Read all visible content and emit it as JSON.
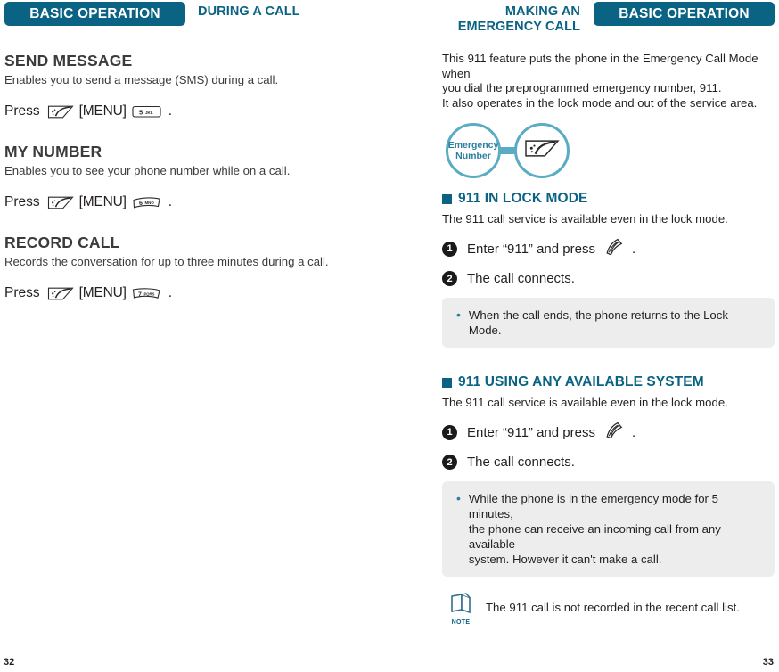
{
  "header": {
    "left_banner": "BASIC OPERATION",
    "left_crumb": "DURING A CALL",
    "right_crumb_line1": "MAKING AN",
    "right_crumb_line2": "EMERGENCY CALL",
    "right_banner": "BASIC OPERATION",
    "banner_color": "#0a6383",
    "crumb_color": "#0a6383"
  },
  "left_page": {
    "features": [
      {
        "title": "SEND MESSAGE",
        "desc": "Enables you to send a message (SMS) during a call.",
        "press_label": "Press",
        "menu_label": "[MENU]",
        "key_label": "5",
        "key_sub": "JKL",
        "period": "."
      },
      {
        "title": "MY NUMBER",
        "desc": "Enables you to see your phone number while on a call.",
        "press_label": "Press",
        "menu_label": "[MENU]",
        "key_label": "6",
        "key_sub": "MNO",
        "period": "."
      },
      {
        "title": "RECORD CALL",
        "desc": "Records the conversation for up to three minutes during a call.",
        "press_label": "Press",
        "menu_label": "[MENU]",
        "key_label": "7",
        "key_sub": "PQRS",
        "period": "."
      }
    ]
  },
  "right_page": {
    "intro_line1": "This 911 feature puts the phone in the Emergency Call Mode when",
    "intro_line2": "you dial the preprogrammed emergency number, 911.",
    "intro_line3": "It also operates in the lock mode and out of the service area.",
    "diagram": {
      "circle_label_line1": "Emergency",
      "circle_label_line2": "Number",
      "circle_color": "#5aabc4",
      "text_color": "#2d7fa0"
    },
    "sections": [
      {
        "heading": "911 IN LOCK MODE",
        "subtext": "The 911 call service is available even in the lock mode.",
        "steps": [
          {
            "num": "1",
            "text_before": "Enter “911” and press",
            "text_after": "."
          },
          {
            "num": "2",
            "text_before": "The call connects.",
            "text_after": ""
          }
        ],
        "callout": [
          "When the call ends, the phone returns to the Lock Mode."
        ]
      },
      {
        "heading": "911 USING ANY AVAILABLE SYSTEM",
        "subtext": "The 911 call service is available even in the lock mode.",
        "steps": [
          {
            "num": "1",
            "text_before": "Enter “911” and press",
            "text_after": "."
          },
          {
            "num": "2",
            "text_before": "The call connects.",
            "text_after": ""
          }
        ],
        "callout": [
          "While the phone is in the emergency mode for 5 minutes,",
          "the phone can receive an incoming call from any available",
          "system. However it can't make a call."
        ]
      }
    ],
    "note": {
      "label": "NOTE",
      "text": "The 911 call is not recorded in the recent call list."
    }
  },
  "footer": {
    "left_page_number": "32",
    "right_page_number": "33"
  }
}
